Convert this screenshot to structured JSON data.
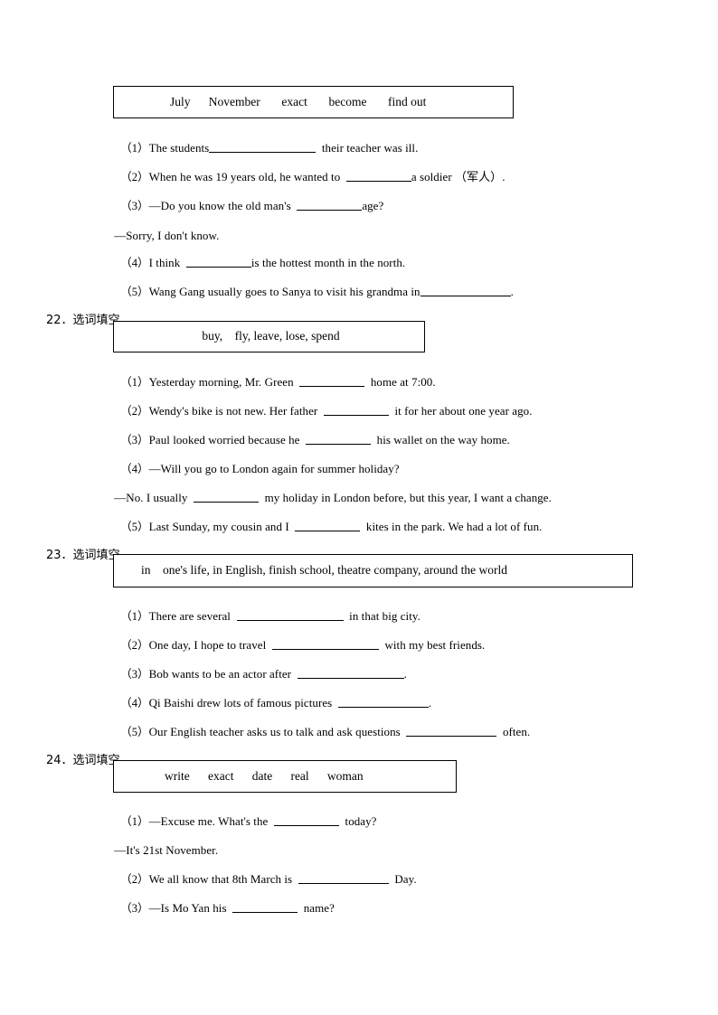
{
  "document": {
    "type": "worksheet",
    "language_note": "English vocabulary fill-in-the-blank exercises with Chinese section headings"
  },
  "sections": [
    {
      "id": "q21",
      "number": "",
      "heading": "",
      "wordbank": "July      November       exact       become       find out",
      "words": [
        "July",
        "November",
        "exact",
        "become",
        "find out"
      ],
      "items": [
        {
          "num": "（1）",
          "before": "The students",
          "blank": "b-2xl",
          "after": "  their teacher was ill."
        },
        {
          "num": "（2）",
          "before": "When he was 19 years old, he wanted to  ",
          "blank": "b-md",
          "after": "a soldier （军人）."
        },
        {
          "num": "（3）",
          "before": "—Do you know the old man's  ",
          "blank": "b-md",
          "after": "age?"
        },
        {
          "num": "",
          "dash": "—Sorry, I don't know."
        },
        {
          "num": "（4）",
          "before": "I think  ",
          "blank": "b-md",
          "after": "is the hottest month in the north."
        },
        {
          "num": "（5）",
          "before": "Wang Gang usually goes to Sanya to visit his grandma in",
          "blank": "b-xl",
          "after": "."
        }
      ]
    },
    {
      "id": "q22",
      "number": "22",
      "heading": "选词填空",
      "heading_full": "22．选词填空",
      "wordbank": "buy,    fly, leave, lose, spend",
      "words": [
        "buy,",
        "fly,",
        "leave,",
        "lose,",
        "spend"
      ],
      "items": [
        {
          "num": "（1）",
          "before": "Yesterday morning, Mr. Green  ",
          "blank": "b-md",
          "after": "  home at 7:00."
        },
        {
          "num": "（2）",
          "before": "Wendy's bike is not new. Her father  ",
          "blank": "b-md",
          "after": "  it for her about one year ago."
        },
        {
          "num": "（3）",
          "before": "Paul looked worried because he  ",
          "blank": "b-md",
          "after": "  his wallet on the way home."
        },
        {
          "num": "（4）",
          "before": "—Will you go to London again for summer holiday?",
          "blank": "",
          "after": ""
        },
        {
          "num": "",
          "dash_before": "—No. I usually  ",
          "dash_blank": "b-md",
          "dash_after": "  my holiday in London before, but this year, I want a change."
        },
        {
          "num": "（5）",
          "before": "Last Sunday, my cousin and I  ",
          "blank": "b-md",
          "after": "  kites in the park. We had a lot of fun."
        }
      ]
    },
    {
      "id": "q23",
      "number": "23",
      "heading": "选词填空",
      "heading_full": "23．选词填空",
      "wordbank": "in    one's life, in English, finish school, theatre company, around the world",
      "words": [
        "in",
        "one's life,",
        "in English,",
        "finish school,",
        "theatre company,",
        "around the world"
      ],
      "items": [
        {
          "num": "（1）",
          "before": "There are several  ",
          "blank": "b-2xl",
          "after": "  in that big city."
        },
        {
          "num": "（2）",
          "before": "One day, I hope to travel  ",
          "blank": "b-2xl",
          "after": "  with my best friends."
        },
        {
          "num": "（3）",
          "before": "Bob wants to be an actor after  ",
          "blank": "b-2xl",
          "after": "."
        },
        {
          "num": "（4）",
          "before": "Qi Baishi drew lots of famous pictures  ",
          "blank": "b-xl",
          "after": "."
        },
        {
          "num": "（5）",
          "before": "Our English teacher asks us to talk and ask questions  ",
          "blank": "b-xl",
          "after": "  often."
        }
      ]
    },
    {
      "id": "q24",
      "number": "24",
      "heading": "选词填空",
      "heading_full": "24．选词填空",
      "wordbank": "write      exact      date      real      woman",
      "words": [
        "write",
        "exact",
        "date",
        "real",
        "woman"
      ],
      "items": [
        {
          "num": "（1）",
          "before": "—Excuse me. What's the  ",
          "blank": "b-md",
          "after": "  today?"
        },
        {
          "num": "",
          "dash": "—It's 21st November."
        },
        {
          "num": "（2）",
          "before": "We all know that 8th March is  ",
          "blank": "b-xl",
          "after": "  Day."
        },
        {
          "num": "（3）",
          "before": "—Is Mo Yan his  ",
          "blank": "b-md",
          "after": "  name?"
        }
      ]
    }
  ],
  "lines": {
    "s21_i1_num": "（1）",
    "s21_i1_before": "The students",
    "s21_i1_after": "  their teacher was ill.",
    "s21_i2_num": "（2）",
    "s21_i2_before": "When he was 19 years old, he wanted to  ",
    "s21_i2_after": "a soldier （军人）.",
    "s21_i3_num": "（3）",
    "s21_i3_before": "—Do you know the old man's  ",
    "s21_i3_after": "age?",
    "s21_dash1": "—Sorry, I don't know.",
    "s21_i4_num": "（4）",
    "s21_i4_before": "I think  ",
    "s21_i4_after": "is the hottest month in the north.",
    "s21_i5_num": "（5）",
    "s21_i5_before": "Wang Gang usually goes to Sanya to visit his grandma in",
    "s21_i5_after": ".",
    "s22_i1_num": "（1）",
    "s22_i1_before": "Yesterday morning, Mr. Green  ",
    "s22_i1_after": "  home at 7:00.",
    "s22_i2_num": "（2）",
    "s22_i2_before": "Wendy's bike is not new. Her father  ",
    "s22_i2_after": "  it for her about one year ago.",
    "s22_i3_num": "（3）",
    "s22_i3_before": "Paul looked worried because he  ",
    "s22_i3_after": "  his wallet on the way home.",
    "s22_i4_num": "（4）",
    "s22_i4_text": "—Will you go to London again for summer holiday?",
    "s22_dash_before": "—No. I usually  ",
    "s22_dash_after": "  my holiday in London before, but this year, I want a change.",
    "s22_i5_num": "（5）",
    "s22_i5_before": "Last Sunday, my cousin and I  ",
    "s22_i5_after": "  kites in the park. We had a lot of fun.",
    "s23_i1_num": "（1）",
    "s23_i1_before": "There are several  ",
    "s23_i1_after": "  in that big city.",
    "s23_i2_num": "（2）",
    "s23_i2_before": "One day, I hope to travel  ",
    "s23_i2_after": "  with my best friends.",
    "s23_i3_num": "（3）",
    "s23_i3_before": "Bob wants to be an actor after  ",
    "s23_i3_after": ".",
    "s23_i4_num": "（4）",
    "s23_i4_before": "Qi Baishi drew lots of famous pictures  ",
    "s23_i4_after": ".",
    "s23_i5_num": "（5）",
    "s23_i5_before": "Our English teacher asks us to talk and ask questions  ",
    "s23_i5_after": "  often.",
    "s24_i1_num": "（1）",
    "s24_i1_before": "—Excuse me. What's the  ",
    "s24_i1_after": "  today?",
    "s24_dash1": "—It's 21st November.",
    "s24_i2_num": "（2）",
    "s24_i2_before": "We all know that 8th March is  ",
    "s24_i2_after": "  Day.",
    "s24_i3_num": "（3）",
    "s24_i3_before": "—Is Mo Yan his  ",
    "s24_i3_after": "  name?"
  }
}
